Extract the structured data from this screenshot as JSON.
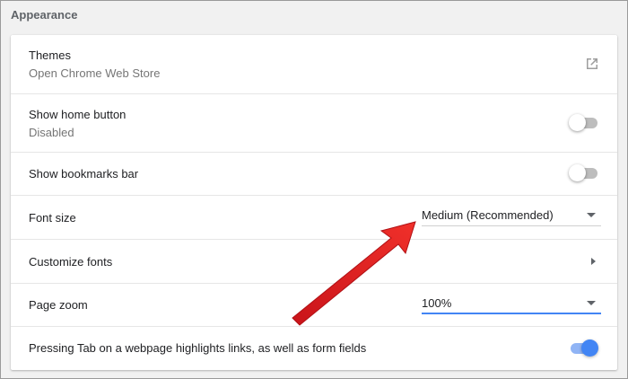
{
  "section": {
    "title": "Appearance"
  },
  "themes": {
    "label": "Themes",
    "sublabel": "Open Chrome Web Store",
    "icon": "open-in-new-icon"
  },
  "home_button": {
    "label": "Show home button",
    "sublabel": "Disabled",
    "enabled": false
  },
  "bookmarks_bar": {
    "label": "Show bookmarks bar",
    "enabled": false
  },
  "font_size": {
    "label": "Font size",
    "value": "Medium (Recommended)"
  },
  "customize_fonts": {
    "label": "Customize fonts"
  },
  "page_zoom": {
    "label": "Page zoom",
    "value": "100%"
  },
  "tab_highlight": {
    "label": "Pressing Tab on a webpage highlights links, as well as form fields",
    "enabled": true
  },
  "colors": {
    "accent": "#4285f4",
    "annotation_arrow": "#e0201f"
  }
}
